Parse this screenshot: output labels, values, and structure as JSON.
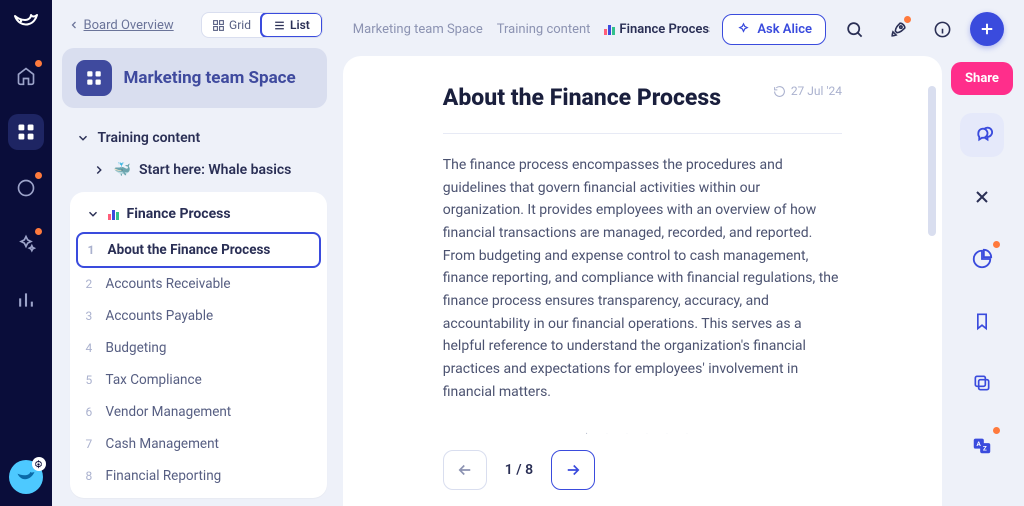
{
  "board_overview_label": "Board Overview",
  "view_toggle": {
    "grid": "Grid",
    "list": "List"
  },
  "space": {
    "title": "Marketing team Space"
  },
  "tree": {
    "training_label": "Training content",
    "start_here_label": "Start here: Whale basics",
    "start_here_emoji": "🐳",
    "finance_label": "Finance Process"
  },
  "toc": [
    {
      "n": "1",
      "label": "About the Finance Process"
    },
    {
      "n": "2",
      "label": "Accounts Receivable"
    },
    {
      "n": "3",
      "label": "Accounts Payable"
    },
    {
      "n": "4",
      "label": "Budgeting"
    },
    {
      "n": "5",
      "label": "Tax Compliance"
    },
    {
      "n": "6",
      "label": "Vendor Management"
    },
    {
      "n": "7",
      "label": "Cash Management"
    },
    {
      "n": "8",
      "label": "Financial Reporting"
    }
  ],
  "breadcrumb": {
    "a": "Marketing team Space",
    "b": "Training content",
    "c": "Finance Process"
  },
  "ask_label": "Ask Alice",
  "share_label": "Share",
  "doc": {
    "title": "About the Finance Process",
    "date": "27 Jul '24",
    "body": "The finance process encompasses the procedures and guidelines that govern financial activities within our organization. It provides employees with an overview of how financial transactions are managed, recorded, and reported. From budgeting and expense control to cash management, finance reporting, and compliance with financial regulations, the finance process ensures transparency, accuracy, and accountability in our financial operations. This serves as a helpful reference to understand the organization's financial practices and expectations for employees' involvement in financial matters."
  },
  "pager": {
    "label": "1 / 8"
  }
}
